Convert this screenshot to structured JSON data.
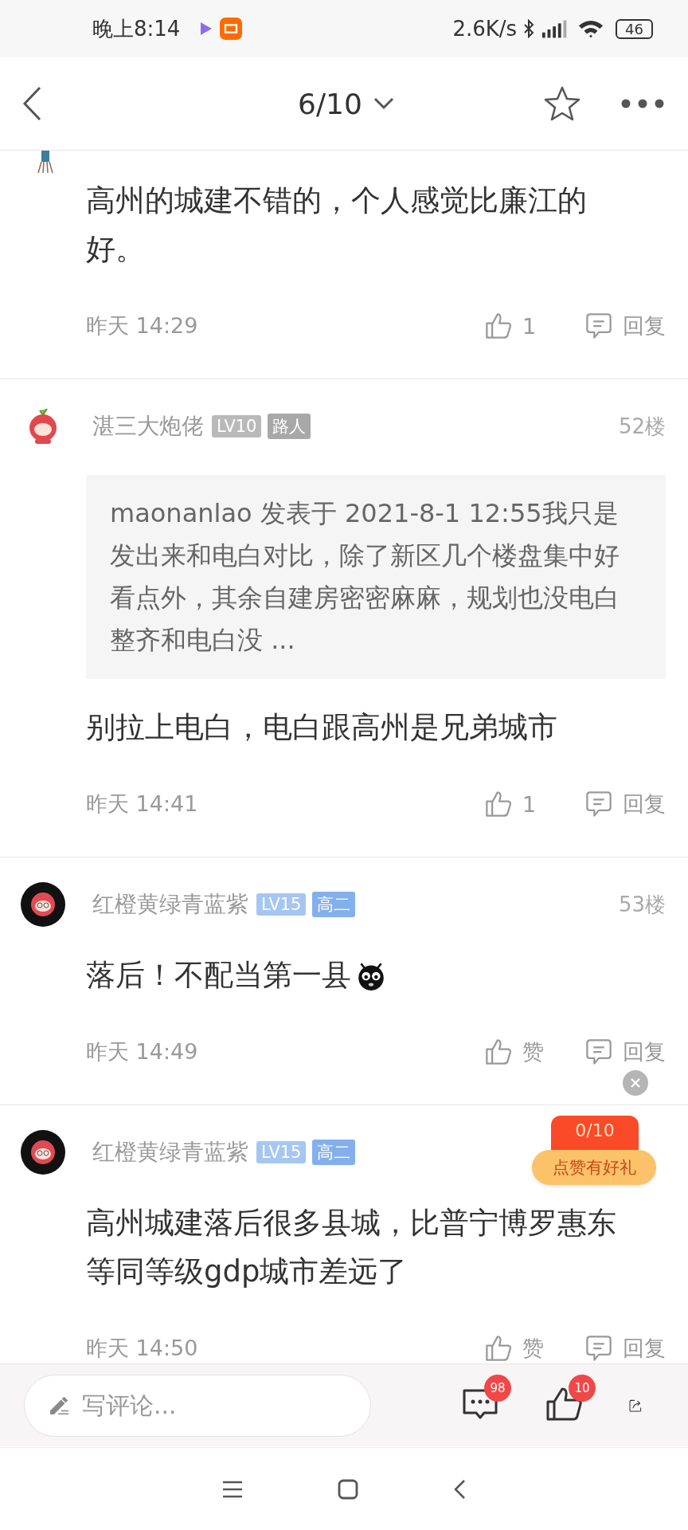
{
  "status_bar": {
    "time": "晚上8:14",
    "speed": "2.6K/s",
    "battery": "46"
  },
  "header": {
    "page": "6/10",
    "favorited": false
  },
  "comments": [
    {
      "avatar": {
        "kind": "figure"
      },
      "body": "高州的城建不错的，个人感觉比廉江的好。",
      "time": "昨天 14:29",
      "likes": "1",
      "reply": "回复"
    },
    {
      "avatar": {
        "kind": "fruit"
      },
      "name": "湛三大炮佬",
      "badges": [
        {
          "text": "LV10",
          "color": "#b9b9b9"
        },
        {
          "text": "路人",
          "color": "#a8a8a8"
        }
      ],
      "floor": "52楼",
      "quote": "maonanlao 发表于 2021-8-1 12:55我只是发出来和电白对比，除了新区几个楼盘集中好看点外，其余自建房密密麻麻，规划也没电白整齐和电白没 ...",
      "body": "别拉上电白，电白跟高州是兄弟城市",
      "time": "昨天 14:41",
      "likes": "1",
      "reply": "回复"
    },
    {
      "avatar": {
        "kind": "fruit-dark"
      },
      "name": "红橙黄绿青蓝紫",
      "badges": [
        {
          "text": "LV15",
          "color": "#a6c6f2"
        },
        {
          "text": "高二",
          "color": "#83afec"
        }
      ],
      "floor": "53楼",
      "body": "落后！不配当第一县",
      "emoji": true,
      "time": "昨天 14:49",
      "likes": "赞",
      "reply": "回复"
    },
    {
      "avatar": {
        "kind": "fruit-dark"
      },
      "name": "红橙黄绿青蓝紫",
      "badges": [
        {
          "text": "LV15",
          "color": "#a6c6f2"
        },
        {
          "text": "高二",
          "color": "#83afec"
        }
      ],
      "body": "高州城建落后很多县城，比普宁博罗惠东等同等级gdp城市差远了",
      "time": "昨天 14:50",
      "likes": "赞",
      "reply": "回复"
    }
  ],
  "promo": {
    "count": "0/10",
    "label": "点赞有好礼"
  },
  "bottom_bar": {
    "placeholder": "写评论...",
    "comments_badge": "98",
    "likes_badge": "10"
  }
}
